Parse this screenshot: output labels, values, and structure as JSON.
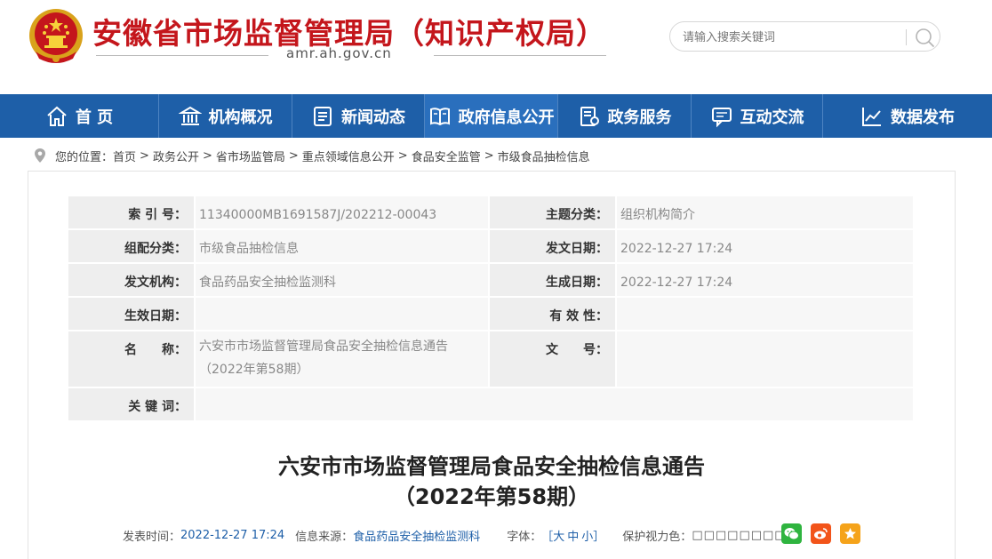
{
  "header": {
    "site_title": "安徽省市场监督管理局（知识产权局）",
    "site_domain": "amr.ah.gov.cn",
    "search_placeholder": "请输入搜索关键词"
  },
  "nav": {
    "items": [
      {
        "label": "首 页",
        "icon": "home-icon"
      },
      {
        "label": "机构概况",
        "icon": "institution-icon"
      },
      {
        "label": "新闻动态",
        "icon": "news-icon"
      },
      {
        "label": "政府信息公开",
        "icon": "open-book-icon"
      },
      {
        "label": "政务服务",
        "icon": "service-form-icon"
      },
      {
        "label": "互动交流",
        "icon": "chat-icon"
      },
      {
        "label": "数据发布",
        "icon": "chart-icon"
      }
    ],
    "active_index": 3
  },
  "breadcrumb": {
    "prefix": "您的位置：",
    "items": [
      "首页",
      "政务公开",
      "省市场监管局",
      "重点领域信息公开",
      "食品安全监管",
      "市级食品抽检信息"
    ],
    "separator": ">"
  },
  "meta": {
    "index_label": "索 引 号：",
    "index_value": "11340000MB1691587J/202212-00043",
    "topic_label": "主题分类：",
    "topic_value": "组织机构简介",
    "category_label": "组配分类：",
    "category_value": "市级食品抽检信息",
    "pubdate_label": "发文日期：",
    "pubdate_value": "2022-12-27 17:24",
    "org_label": "发文机构：",
    "org_value": "食品药品安全抽检监测科",
    "created_label": "生成日期：",
    "created_value": "2022-12-27 17:24",
    "effective_label": "生效日期：",
    "effective_value": "",
    "valid_label": "有 效 性：",
    "valid_value": "",
    "name_label": "名　　称：",
    "name_value_line1": "六安市市场监督管理局食品安全抽检信息通告",
    "name_value_line2": "（2022年第58期）",
    "docno_label": "文　　号：",
    "docno_value": "",
    "keywords_label": "关 键 词：",
    "keywords_value": ""
  },
  "article": {
    "title_line1": "六安市市场监督管理局食品安全抽检信息通告",
    "title_line2": "（2022年第58期）",
    "time_label": "发表时间：",
    "time_value": "2022-12-27 17:24",
    "source_label": "信息来源：",
    "source_value": "食品药品安全抽检监测科",
    "font_label": "字体：",
    "font_open": "［",
    "font_large": "大",
    "font_medium": "中",
    "font_small": "小",
    "font_close": "］",
    "vision_label": "保护视力色：",
    "vision_swatches": "□□□□□□□□□"
  },
  "colors": {
    "title_red": "#c4161c",
    "nav_blue": "#1e5fa8",
    "wechat_green": "#2fb43f",
    "weibo_red": "#f2541a",
    "fav_orange": "#f5a31a"
  }
}
